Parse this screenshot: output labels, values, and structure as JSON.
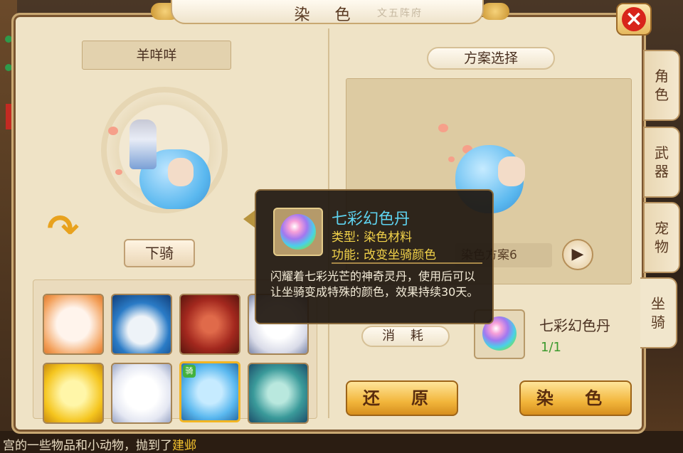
{
  "window": {
    "title": "染 色",
    "title_deco": "文五阵府"
  },
  "mount": {
    "name": "羊咩咩",
    "dismount_label": "下骑"
  },
  "scheme": {
    "label": "方案选择",
    "current": "染色方案6"
  },
  "consume": {
    "label": "消 耗",
    "item_name": "七彩幻色丹",
    "item_count": "1/1"
  },
  "buttons": {
    "restore": "还 原",
    "dye": "染 色"
  },
  "side_tabs": [
    "角色",
    "武器",
    "宠物",
    "坐骑"
  ],
  "tooltip": {
    "name": "七彩幻色丹",
    "type": "类型: 染色材料",
    "function": "功能: 改变坐骑颜色",
    "description": "闪耀着七彩光芒的神奇灵丹，使用后可以让坐骑变成特殊的颜色，效果持续30天。"
  },
  "chat": {
    "text_prefix": "宫的一些物品和小动物，抛到了",
    "text_highlight": "建邺"
  },
  "colors": {
    "panel_bg": "#efe3c6",
    "accent_gold": "#f2b63c",
    "tooltip_name": "#5ed3f0",
    "tooltip_attr": "#f3d34a",
    "count_green": "#3c9a2e",
    "close_red": "#d8241b"
  },
  "icons": [
    "close-icon",
    "rotate-icon",
    "next-arrow-icon",
    "rainbow-orb-icon"
  ]
}
